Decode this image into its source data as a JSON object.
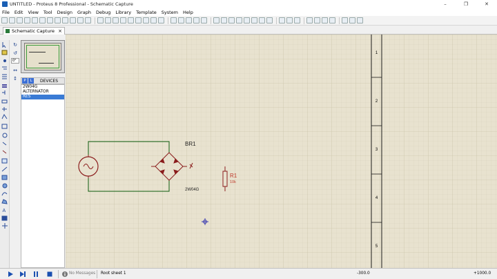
{
  "window": {
    "title": "UNTITLED - Proteus 8 Professional - Schematic Capture",
    "minimize": "–",
    "maximize": "❐",
    "close": "✕"
  },
  "menu": {
    "items": [
      "File",
      "Edit",
      "View",
      "Tool",
      "Design",
      "Graph",
      "Debug",
      "Library",
      "Template",
      "System",
      "Help"
    ]
  },
  "tab": {
    "label": "Schematic Capture",
    "close": "×"
  },
  "side_panel": {
    "zoom_value": "0°",
    "pick_label": "P",
    "library_label": "L",
    "devices_header": "DEVICES",
    "devices": [
      "2W04G",
      "ALTERNATOR",
      "RES"
    ],
    "selected_device": "RES"
  },
  "schematic": {
    "bridge_ref": "BR1",
    "bridge_value": "2W04G",
    "resistor_ref": "R1",
    "resistor_value": "10k",
    "border_rows": [
      "1",
      "2",
      "3",
      "4",
      "5"
    ],
    "wire_color": "#0b5a0b",
    "component_color": "#8a1c1c",
    "label_color": "#c0392b",
    "grid_background": "#e8e2cf",
    "grid_line_color": "#cfc7b0"
  },
  "status": {
    "messages": "No Messages",
    "sheet": "Root sheet 1",
    "coord_x": "-300.0",
    "coord_y": "+1000.0"
  }
}
